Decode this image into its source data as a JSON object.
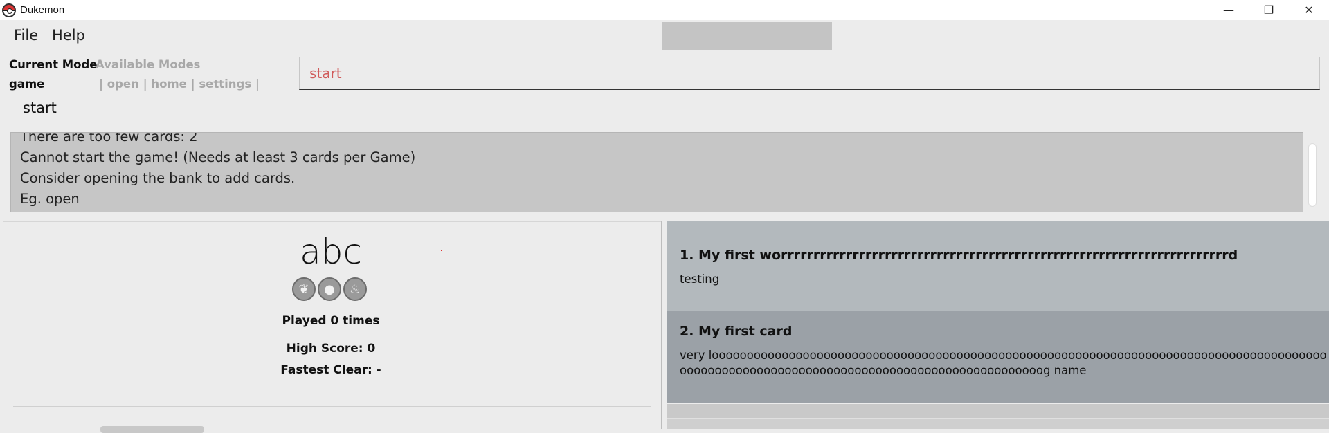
{
  "window": {
    "title": "Dukemon",
    "controls": {
      "minimize": "—",
      "restore": "❐",
      "close": "✕"
    }
  },
  "menu": {
    "file": "File",
    "help": "Help"
  },
  "mode": {
    "current_label": "Current Mode",
    "current_value": "game",
    "available_label": "Available Modes",
    "available_value": "| open | home | settings |"
  },
  "command": {
    "value": "start",
    "echo": "start"
  },
  "result": {
    "lines": [
      "There are too few cards: 2",
      "Cannot start the game! (Needs at least 3 cards per Game)",
      "Consider opening the bank to add cards.",
      "Eg. open"
    ]
  },
  "bank": {
    "title": "abc",
    "badge_icons": [
      "leaf-icon",
      "water-icon",
      "fire-icon"
    ],
    "played": "Played 0 times",
    "high_score": "High Score: 0",
    "fastest_clear": "Fastest Clear:  -"
  },
  "cards": [
    {
      "title": "1.  My first worrrrrrrrrrrrrrrrrrrrrrrrrrrrrrrrrrrrrrrrrrrrrrrrrrrrrrrrrrrrrrrrrrrrrd",
      "desc": "testing"
    },
    {
      "title": "2.  My first card",
      "desc": "very loooooooooooooooooooooooooooooooooooooooooooooooooooooooooooooooooooooooooooooooooooooooooooooooooooooooooooooooooooooooooooooooooooooooooooog name"
    }
  ],
  "colors": {
    "background": "#ececec",
    "result_bg": "#c6c6c6",
    "card1_bg": "#b3b9bd",
    "card2_bg": "#9ba1a7",
    "command_text": "#d05a5a"
  }
}
